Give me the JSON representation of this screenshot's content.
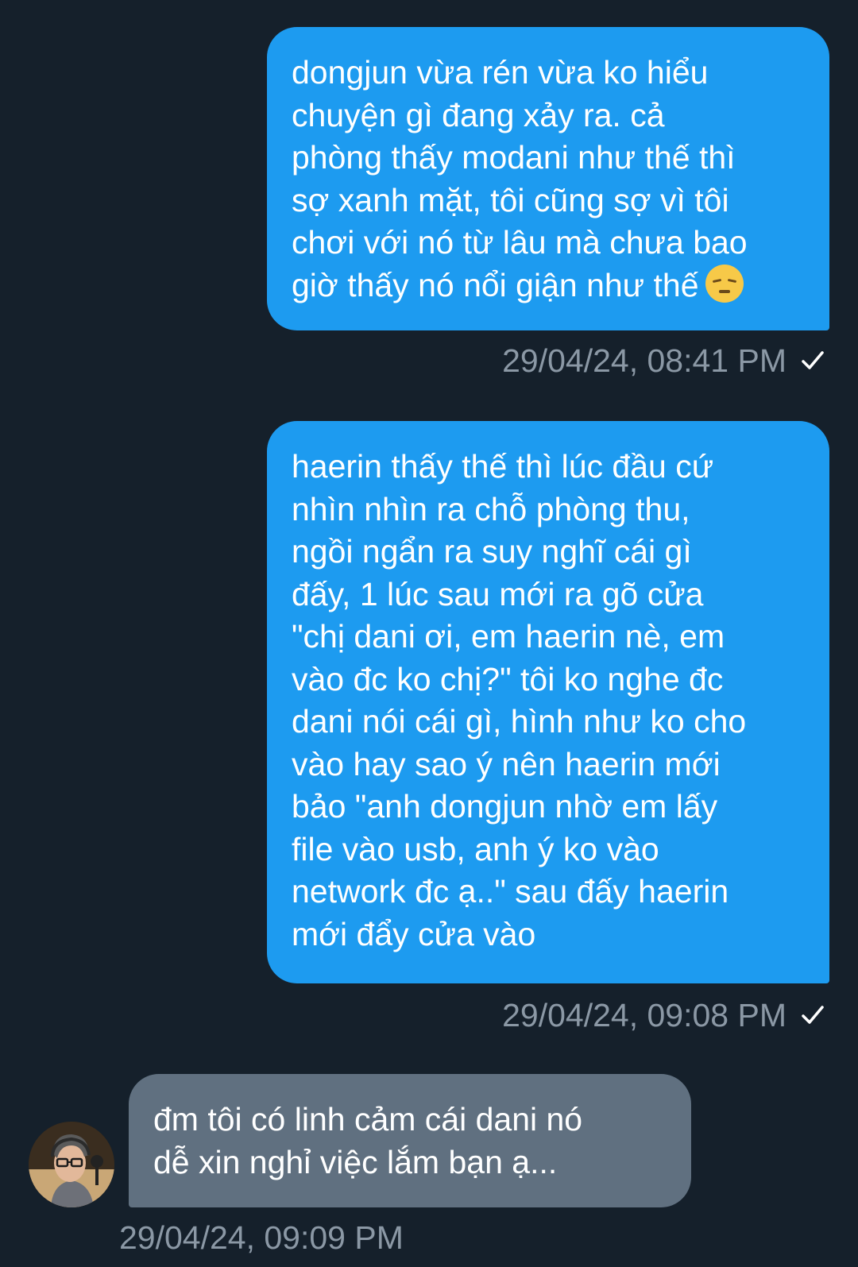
{
  "messages": [
    {
      "direction": "sent",
      "text": "dongjun vừa rén vừa ko hiểu\nchuyện gì đang xảy ra. cả\nphòng thấy modani như thế thì\nsợ xanh mặt, tôi cũng sợ vì tôi\nchơi với nó từ lâu mà chưa bao\ngiờ thấy nó nổi giận như thế",
      "emoji": "pensive-face",
      "timestamp": "29/04/24, 08:41 PM",
      "status_icon": "check-icon"
    },
    {
      "direction": "sent",
      "text": "haerin thấy thế thì lúc đầu cứ\nnhìn nhìn ra chỗ phòng thu,\nngồi ngẩn ra suy nghĩ cái gì\nđấy, 1 lúc sau mới ra gõ cửa\n\"chị dani ơi, em haerin nè, em\nvào đc ko chị?\" tôi ko nghe đc\ndani nói cái gì, hình như ko cho\nvào hay sao ý nên haerin mới\nbảo \"anh dongjun nhờ em lấy\nfile vào usb, anh ý ko vào\nnetwork đc ạ..\" sau đấy haerin\nmới đẩy cửa vào",
      "timestamp": "29/04/24, 09:08 PM",
      "status_icon": "check-icon"
    },
    {
      "direction": "received",
      "text": "đm tôi có linh cảm cái dani nó\ndễ xin nghỉ việc lắm bạn ạ...",
      "timestamp": "29/04/24, 09:09 PM",
      "avatar": "avatar"
    }
  ],
  "colors": {
    "background": "#15202b",
    "sent_bubble": "#1d9bf0",
    "received_bubble": "#607080",
    "timestamp": "#8b98a5",
    "text": "#ffffff"
  }
}
